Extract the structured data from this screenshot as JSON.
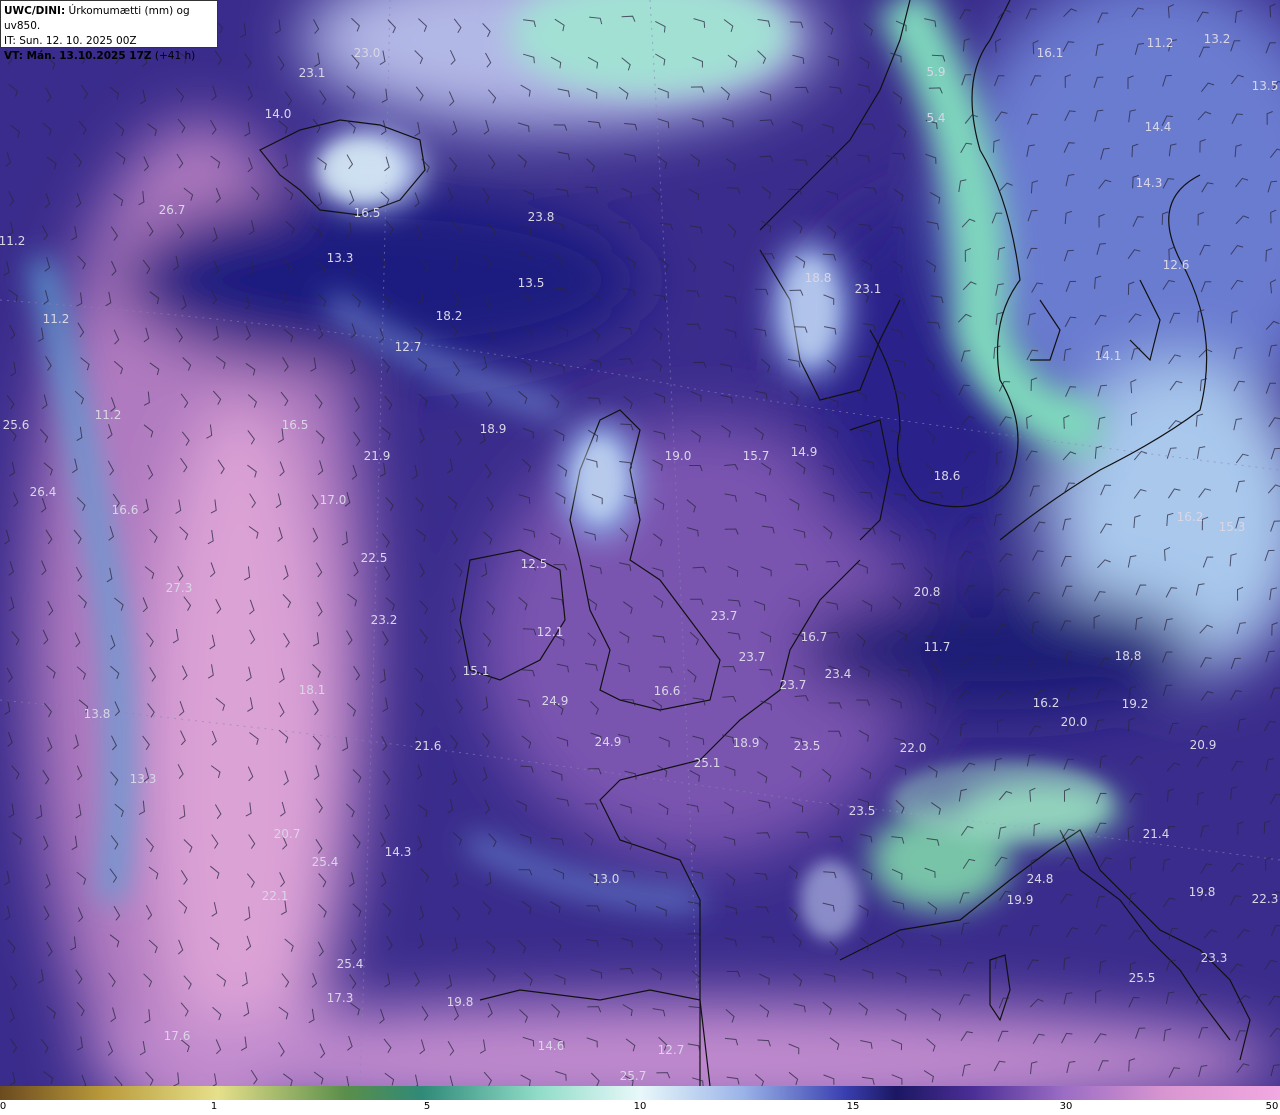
{
  "header": {
    "model": "UWC/DINI:",
    "product": " Úrkomumætti (mm) og uv850.",
    "init_time": "IT: Sun. 12. 10. 2025 00Z",
    "valid_prefix": "VT: Mán. 13.10.2025 17Z",
    "lead": " (+41 h)"
  },
  "colorbar": {
    "ticks": [
      {
        "label": "0",
        "value": 0
      },
      {
        "label": "1",
        "value": 1
      },
      {
        "label": "5",
        "value": 5
      },
      {
        "label": "10",
        "value": 10
      },
      {
        "label": "15",
        "value": 15
      },
      {
        "label": "30",
        "value": 30
      },
      {
        "label": "50",
        "value": 50
      }
    ]
  },
  "colors": {
    "ocean_purple": "#3a2c8c",
    "deep_blue": "#1c1a78",
    "pink_moist": "#c790cc",
    "teal_dry": "#5ec4a8",
    "label_text": "#d9d6e6",
    "coast": "#111111"
  },
  "map_labels": [
    "23.0",
    "23.1",
    "14.0",
    "16.5",
    "26.7",
    "11.2",
    "13.3",
    "13.5",
    "23.8",
    "18.2",
    "12.7",
    "11.2",
    "25.6",
    "16.5",
    "18.9",
    "19.0",
    "15.7",
    "14.9",
    "11.2",
    "21.9",
    "26.4",
    "16.6",
    "17.0",
    "22.5",
    "27.3",
    "23.2",
    "12.5",
    "12.1",
    "15.1",
    "13.8",
    "18.1",
    "24.9",
    "16.6",
    "23.7",
    "23.7",
    "23.7",
    "16.7",
    "23.4",
    "13.3",
    "21.6",
    "24.9",
    "18.9",
    "25.1",
    "23.5",
    "20.7",
    "25.4",
    "14.3",
    "13.0",
    "22.1",
    "25.4",
    "17.3",
    "19.8",
    "17.6",
    "14.6",
    "12.7",
    "25.7",
    "16.1",
    "11.2",
    "13.2",
    "13.5",
    "5.9",
    "5.4",
    "14.4",
    "14.3",
    "18.8",
    "23.1",
    "12.6",
    "14.1",
    "18.6",
    "16.2",
    "15.3",
    "20.8",
    "11.7",
    "18.8",
    "19.2",
    "16.2",
    "20.0",
    "20.9",
    "22.0",
    "23.5",
    "21.4",
    "24.8",
    "19.9",
    "19.8",
    "22.3",
    "23.3",
    "25.5"
  ]
}
